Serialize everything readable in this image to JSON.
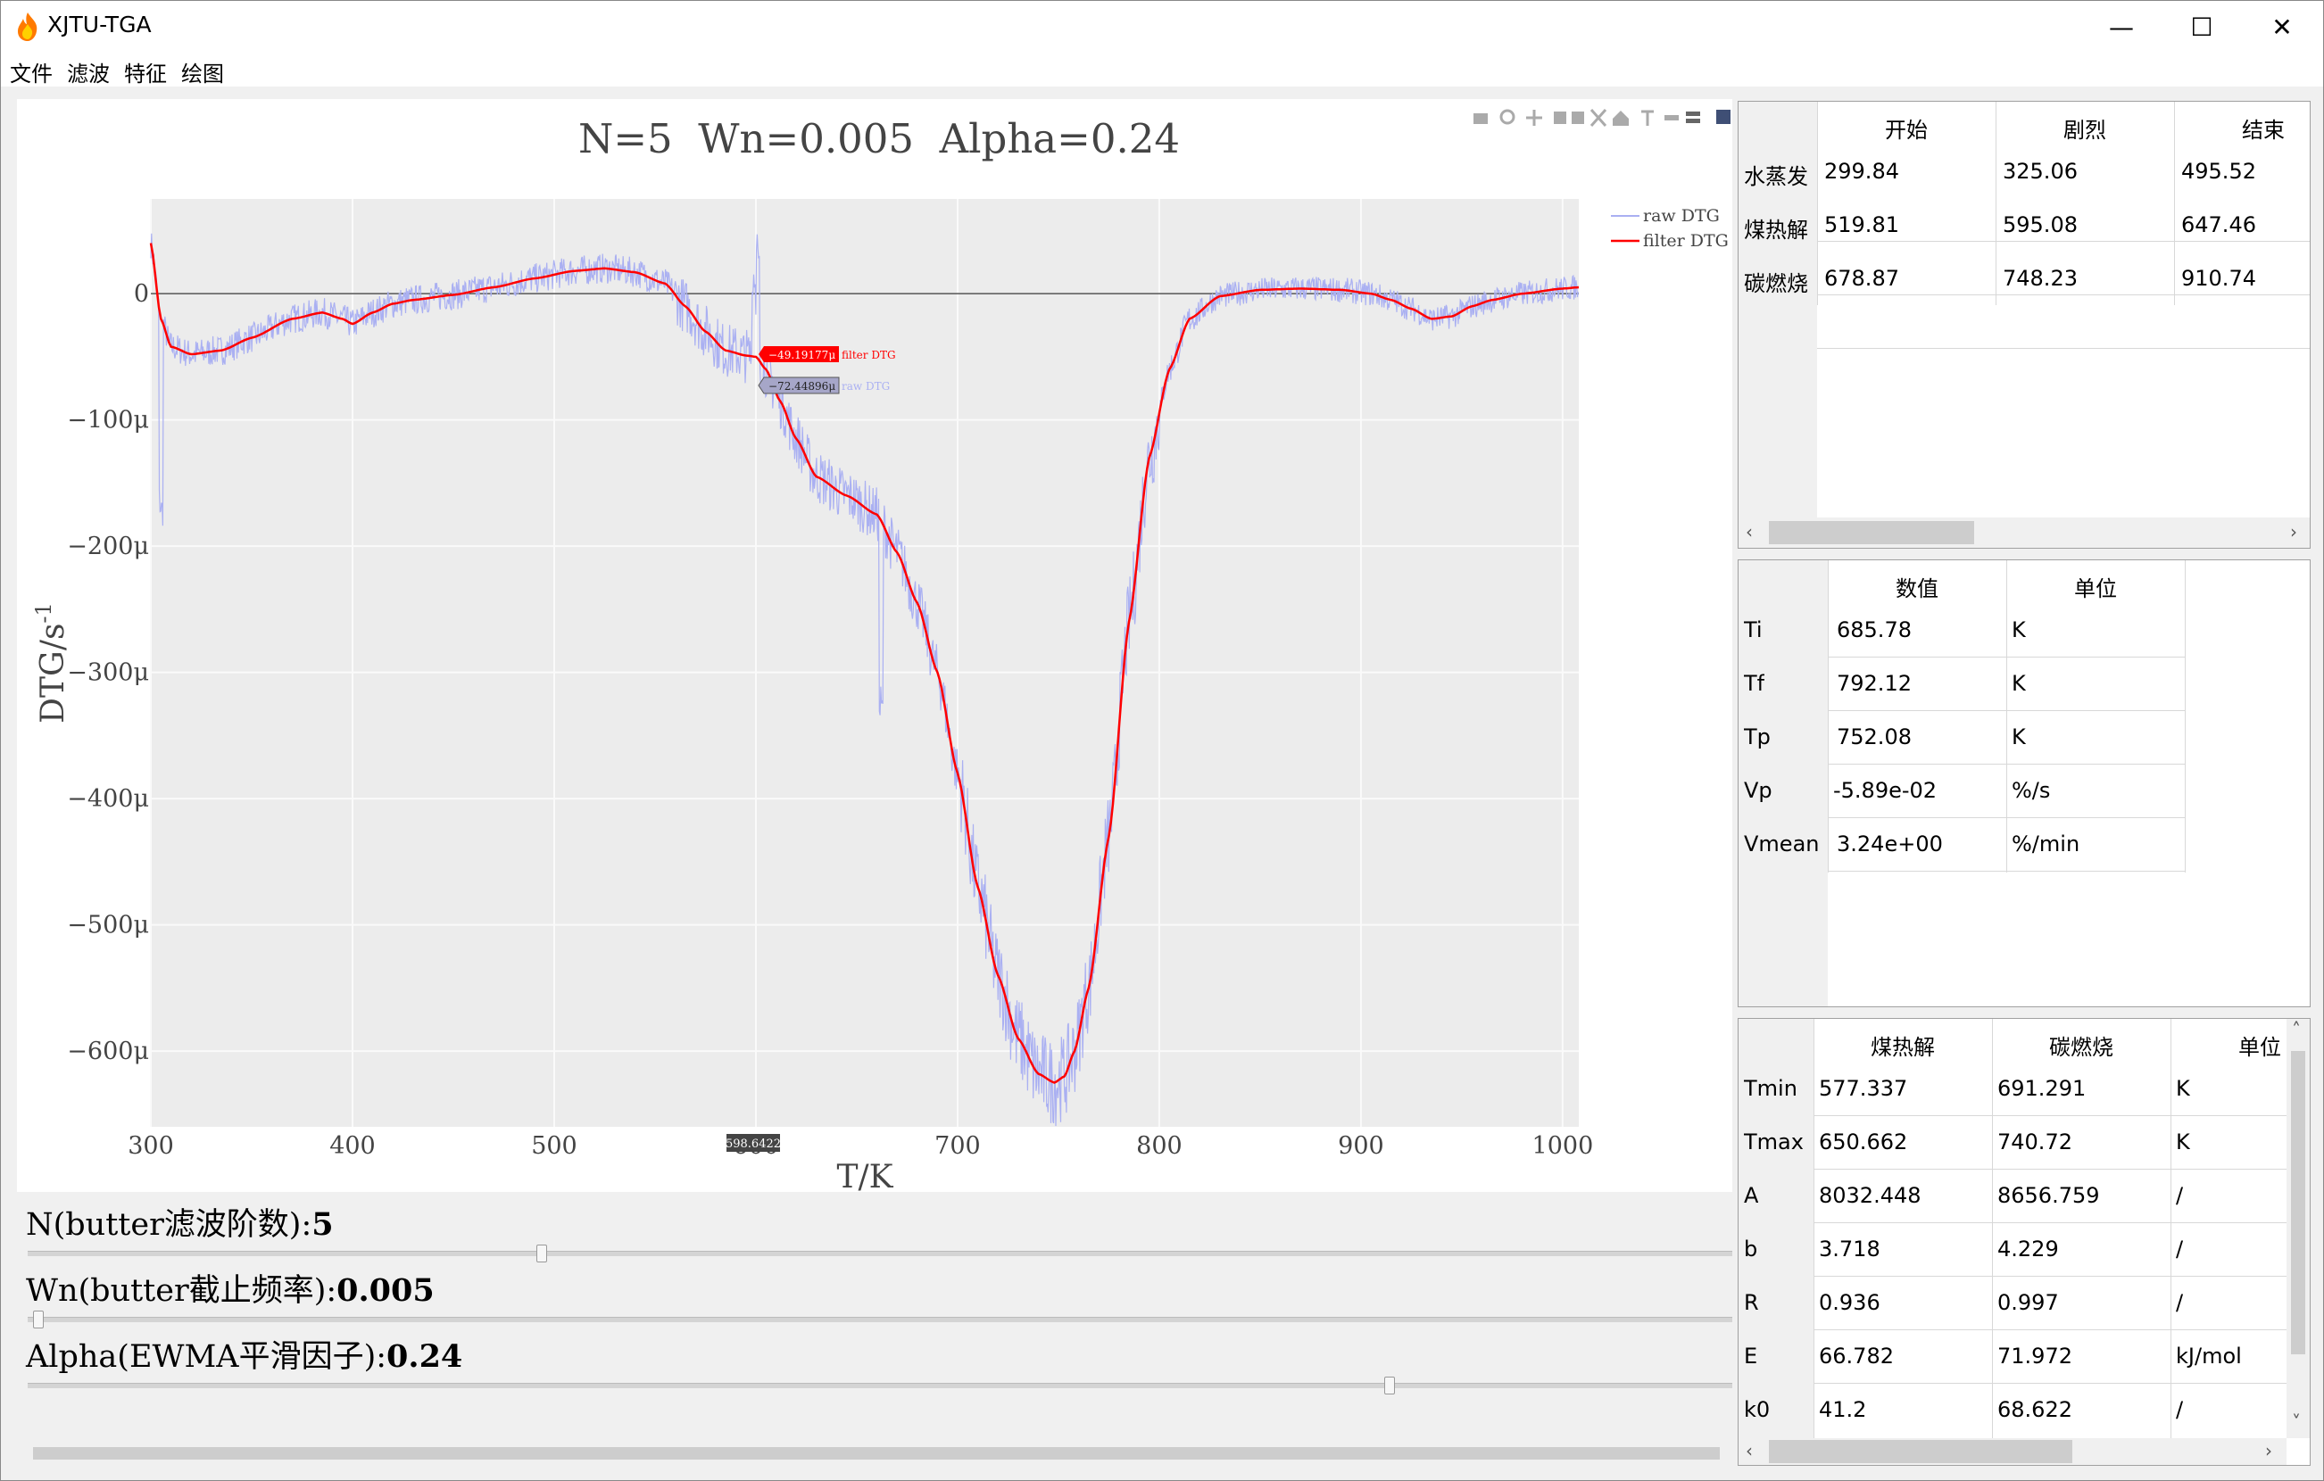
{
  "window": {
    "title": "XJTU-TGA",
    "minimize": "—",
    "maximize": "☐",
    "close": "✕"
  },
  "menu": [
    "文件",
    "滤波",
    "特征",
    "绘图"
  ],
  "chart_data": {
    "type": "line",
    "title": "N=5  Wn=0.005  Alpha=0.24",
    "xlabel": "T/K",
    "ylabel": "DTG/s",
    "ylabel_sup": "-1",
    "xlim": [
      300,
      1008
    ],
    "ylim": [
      -660,
      75
    ],
    "x_ticks": [
      300,
      400,
      500,
      600,
      700,
      800,
      900,
      1000
    ],
    "x_tick_labels": [
      "300",
      "400",
      "500",
      "600",
      "700",
      "800",
      "900",
      "1000"
    ],
    "y_ticks": [
      0,
      -100,
      -200,
      -300,
      -400,
      -500,
      -600
    ],
    "y_tick_labels": [
      "0",
      "−100μ",
      "−200μ",
      "−300μ",
      "−400μ",
      "−500μ",
      "−600μ"
    ],
    "grid": true,
    "legend_position": "top-right",
    "series": [
      {
        "name": "raw DTG",
        "color": "#aab0f2"
      },
      {
        "name": "filter DTG",
        "color": "#ff0000",
        "x": [
          300,
          305,
          310,
          320,
          335,
          350,
          370,
          385,
          395,
          400,
          410,
          420,
          430,
          450,
          470,
          490,
          510,
          525,
          540,
          555,
          565,
          575,
          585,
          595,
          600,
          605,
          612,
          620,
          630,
          645,
          660,
          670,
          680,
          690,
          700,
          710,
          720,
          730,
          740,
          748,
          753,
          758,
          765,
          775,
          785,
          795,
          805,
          815,
          830,
          850,
          870,
          890,
          905,
          915,
          925,
          935,
          945,
          955,
          965,
          980,
          1000,
          1008
        ],
        "y": [
          40,
          -20,
          -42,
          -48,
          -45,
          -35,
          -20,
          -15,
          -20,
          -24,
          -15,
          -8,
          -5,
          -1,
          5,
          12,
          18,
          20,
          17,
          8,
          -10,
          -30,
          -45,
          -49,
          -50,
          -60,
          -85,
          -115,
          -145,
          -160,
          -175,
          -205,
          -245,
          -300,
          -380,
          -470,
          -540,
          -590,
          -618,
          -625,
          -620,
          -600,
          -550,
          -430,
          -260,
          -130,
          -60,
          -20,
          -2,
          3,
          4,
          3,
          0,
          -5,
          -12,
          -20,
          -18,
          -10,
          -5,
          0,
          4,
          5
        ]
      }
    ],
    "tooltips": [
      {
        "series": "filter DTG",
        "value": "−49.19177μ"
      },
      {
        "series": "raw DTG",
        "value": "−72.44896μ"
      }
    ],
    "x_hover_label": "598.6422"
  },
  "sliders": [
    {
      "label": "N(butter滤波阶数):",
      "value": "5",
      "fraction": 0.3
    },
    {
      "label": "Wn(butter截止频率):",
      "value": "0.005",
      "fraction": 0.003
    },
    {
      "label": "Alpha(EWMA平滑因子):",
      "value": "0.24",
      "fraction": 0.8
    }
  ],
  "stage_table": {
    "headers": [
      "开始",
      "剧烈",
      "结束"
    ],
    "rows": [
      {
        "label": "水蒸发",
        "values": [
          "299.84",
          "325.06",
          "495.52"
        ]
      },
      {
        "label": "煤热解",
        "values": [
          "519.81",
          "595.08",
          "647.46"
        ]
      },
      {
        "label": "碳燃烧",
        "values": [
          "678.87",
          "748.23",
          "910.74"
        ]
      }
    ]
  },
  "param_table": {
    "headers": [
      "数值",
      "单位"
    ],
    "rows": [
      {
        "label": "Ti",
        "values": [
          "685.78",
          "K"
        ]
      },
      {
        "label": "Tf",
        "values": [
          "792.12",
          "K"
        ]
      },
      {
        "label": "Tp",
        "values": [
          "752.08",
          "K"
        ]
      },
      {
        "label": "Vp",
        "values": [
          "-5.89e-02",
          "%/s"
        ]
      },
      {
        "label": "Vmean",
        "values": [
          "3.24e+00",
          "%/min"
        ]
      }
    ]
  },
  "kinetic_table": {
    "headers": [
      "煤热解",
      "碳燃烧",
      "单位"
    ],
    "rows": [
      {
        "label": "Tmin",
        "values": [
          "577.337",
          "691.291",
          "K"
        ]
      },
      {
        "label": "Tmax",
        "values": [
          "650.662",
          "740.72",
          "K"
        ]
      },
      {
        "label": "A",
        "values": [
          "8032.448",
          "8656.759",
          "/"
        ]
      },
      {
        "label": "b",
        "values": [
          "3.718",
          "4.229",
          "/"
        ]
      },
      {
        "label": "R",
        "values": [
          "0.936",
          "0.997",
          "/"
        ]
      },
      {
        "label": "E",
        "values": [
          "66.782",
          "71.972",
          "kJ/mol"
        ]
      },
      {
        "label": "k0",
        "values": [
          "41.2",
          "68.622",
          "/"
        ]
      }
    ]
  }
}
